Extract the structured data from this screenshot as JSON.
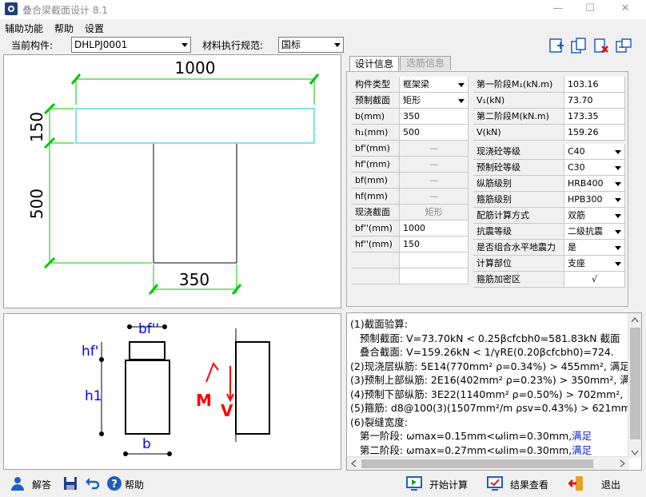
{
  "app": {
    "title": "叠合梁截面设计 8.1"
  },
  "window_controls": {
    "minimize": "—",
    "maximize": "☐",
    "close": "✕"
  },
  "menu": [
    "辅助功能",
    "帮助",
    "设置"
  ],
  "toolbar": {
    "component_label": "当前构件:",
    "component_value": "DHLPJ0001",
    "code_label": "材料执行规范:",
    "code_value": "国标"
  },
  "drawing": {
    "top_width": "1000",
    "top_height": "150",
    "web_height": "500",
    "web_width": "350"
  },
  "sketch": {
    "bf": "bf''",
    "hf": "hf'",
    "h1": "h1",
    "b": "b",
    "M": "M",
    "V": "V"
  },
  "tabs": {
    "design": "设计信息",
    "selected": "选筋信息"
  },
  "left_grid": [
    {
      "label": "构件类型",
      "value": "框架梁",
      "dropdown": true,
      "disabled": false
    },
    {
      "label": "预制截面",
      "value": "矩形",
      "dropdown": true,
      "disabled": false
    },
    {
      "label": "b(mm)",
      "value": "350",
      "dropdown": false,
      "disabled": false
    },
    {
      "label": "h₁(mm)",
      "value": "500",
      "dropdown": false,
      "disabled": false
    },
    {
      "label": "bf'(mm)",
      "value": "—",
      "dropdown": false,
      "disabled": true
    },
    {
      "label": "hf'(mm)",
      "value": "—",
      "dropdown": false,
      "disabled": true
    },
    {
      "label": "bf(mm)",
      "value": "—",
      "dropdown": false,
      "disabled": true
    },
    {
      "label": "hf(mm)",
      "value": "—",
      "dropdown": false,
      "disabled": true
    },
    {
      "label": "现浇截面",
      "value": "矩形",
      "dropdown": false,
      "disabled": true
    },
    {
      "label": "bf''(mm)",
      "value": "1000",
      "dropdown": false,
      "disabled": false
    },
    {
      "label": "hf''(mm)",
      "value": "150",
      "dropdown": false,
      "disabled": false
    },
    {
      "label": "",
      "value": "",
      "dropdown": false,
      "disabled": false
    },
    {
      "label": "",
      "value": "",
      "dropdown": false,
      "disabled": false
    }
  ],
  "right_grid_top": [
    {
      "label": "第一阶段M₁(kN.m)",
      "value": "103.16"
    },
    {
      "label": "V₁(kN)",
      "value": "73.70"
    },
    {
      "label": "第二阶段M(kN.m)",
      "value": "173.35"
    },
    {
      "label": "V(kN)",
      "value": "159.26"
    }
  ],
  "right_grid_bottom": [
    {
      "label": "现浇砼等级",
      "value": "C40",
      "dropdown": true
    },
    {
      "label": "预制砼等级",
      "value": "C30",
      "dropdown": true
    },
    {
      "label": "纵筋级别",
      "value": "HRB400",
      "dropdown": true
    },
    {
      "label": "箍筋级别",
      "value": "HPB300",
      "dropdown": true
    },
    {
      "label": "配筋计算方式",
      "value": "双筋",
      "dropdown": true
    },
    {
      "label": "抗震等级",
      "value": "二级抗震",
      "dropdown": true
    },
    {
      "label": "是否组合水平地震力",
      "value": "是",
      "dropdown": true
    },
    {
      "label": "计算部位",
      "value": "支座",
      "dropdown": true
    },
    {
      "label": "箍筋加密区",
      "value": "√",
      "dropdown": false
    }
  ],
  "results": [
    {
      "text": "(1)截面验算:",
      "ok": ""
    },
    {
      "text": "   预制截面: V=73.70kN < 0.25βcfcbh0=581.83kN 截面",
      "ok": ""
    },
    {
      "text": "   叠合截面: V=159.26kN < 1/γRE(0.20βcfcbh0)=724.",
      "ok": ""
    },
    {
      "text": "(2)现浇层纵筋: 5E14(770mm² ρ=0.34%) > 455mm², 满足",
      "ok": ""
    },
    {
      "text": "(3)预制上部纵筋: 2E16(402mm² ρ=0.23%) > 350mm², 满",
      "ok": ""
    },
    {
      "text": "(4)预制下部纵筋: 3E22(1140mm² ρ=0.50%) > 702mm², ",
      "ok": ""
    },
    {
      "text": "(5)箍筋: d8@100(3)(1507mm²/m ρsv=0.43%) > 621mm²/m",
      "ok": ""
    },
    {
      "text": "(6)裂缝宽度:",
      "ok": ""
    },
    {
      "text": "   第一阶段: ωmax=0.15mm<ωlim=0.30mm,",
      "ok": "满足"
    },
    {
      "text": "   第二阶段: ωmax=0.27mm<ωlim=0.30mm,",
      "ok": "满足"
    }
  ],
  "statusbar": {
    "solve": "解答",
    "help": "帮助",
    "start_calc": "开始计算",
    "view_results": "结果查看",
    "exit": "退出"
  },
  "colors": {
    "dim_green": "#00c800",
    "section_cyan": "#00c8d7",
    "sketch_blue": "#0000ff",
    "sketch_red": "#ff0000"
  }
}
